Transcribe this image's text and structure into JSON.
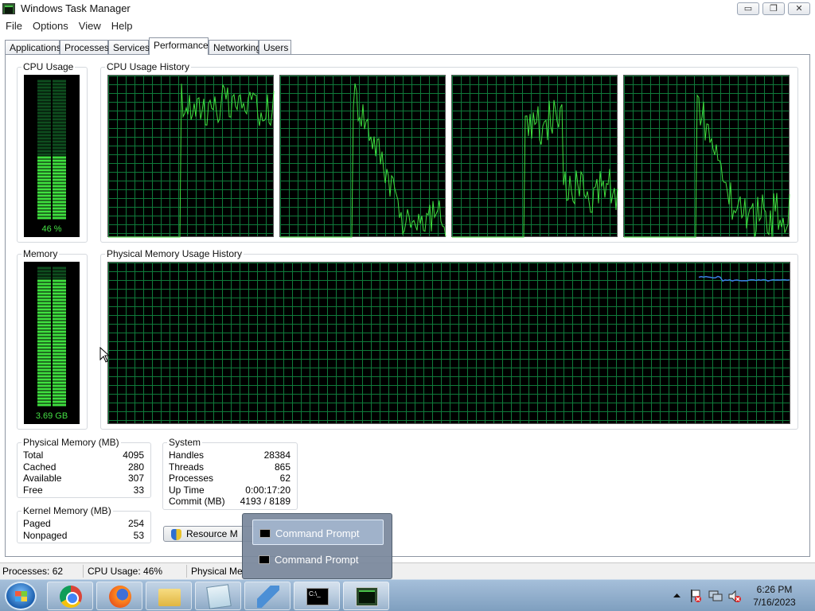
{
  "window": {
    "title": "Windows Task Manager",
    "min_glyph": "▭",
    "max_glyph": "❐",
    "close_glyph": "✕"
  },
  "menu": [
    "File",
    "Options",
    "View",
    "Help"
  ],
  "tabs": [
    "Applications",
    "Processes",
    "Services",
    "Performance",
    "Networking",
    "Users"
  ],
  "active_tab": "Performance",
  "cpu": {
    "usage_label": "CPU Usage",
    "usage_value": "46 %",
    "usage_fraction": 0.46,
    "history_label": "CPU Usage History",
    "line_color": "#3fe03f"
  },
  "memory": {
    "label": "Memory",
    "value": "3.69 GB",
    "usage_fraction": 0.9,
    "history_label": "Physical Memory Usage History",
    "line_color": "#3b7fe6"
  },
  "physical_memory": {
    "label": "Physical Memory (MB)",
    "rows": [
      {
        "k": "Total",
        "v": "4095"
      },
      {
        "k": "Cached",
        "v": "280"
      },
      {
        "k": "Available",
        "v": "307"
      },
      {
        "k": "Free",
        "v": "33"
      }
    ]
  },
  "kernel_memory": {
    "label": "Kernel Memory (MB)",
    "rows": [
      {
        "k": "Paged",
        "v": "254"
      },
      {
        "k": "Nonpaged",
        "v": "53"
      }
    ]
  },
  "system": {
    "label": "System",
    "rows": [
      {
        "k": "Handles",
        "v": "28384"
      },
      {
        "k": "Threads",
        "v": "865"
      },
      {
        "k": "Processes",
        "v": "62"
      },
      {
        "k": "Up Time",
        "v": "0:00:17:20"
      },
      {
        "k": "Commit (MB)",
        "v": "4193 / 8189"
      }
    ]
  },
  "resource_button": "Resource M",
  "statusbar": {
    "processes": "Processes: 62",
    "cpu": "CPU Usage: 46%",
    "memory": "Physical Me"
  },
  "jumplist": [
    "Command Prompt",
    "Command Prompt"
  ],
  "taskbar": {
    "apps": [
      "chrome-icon",
      "firefox-icon",
      "explorer-icon",
      "notepad-icon",
      "visual-studio-icon",
      "command-prompt-icon",
      "task-manager-icon"
    ],
    "cmd_glyph": "C:\\_",
    "time": "6:26 PM",
    "date": "7/16/2023"
  }
}
